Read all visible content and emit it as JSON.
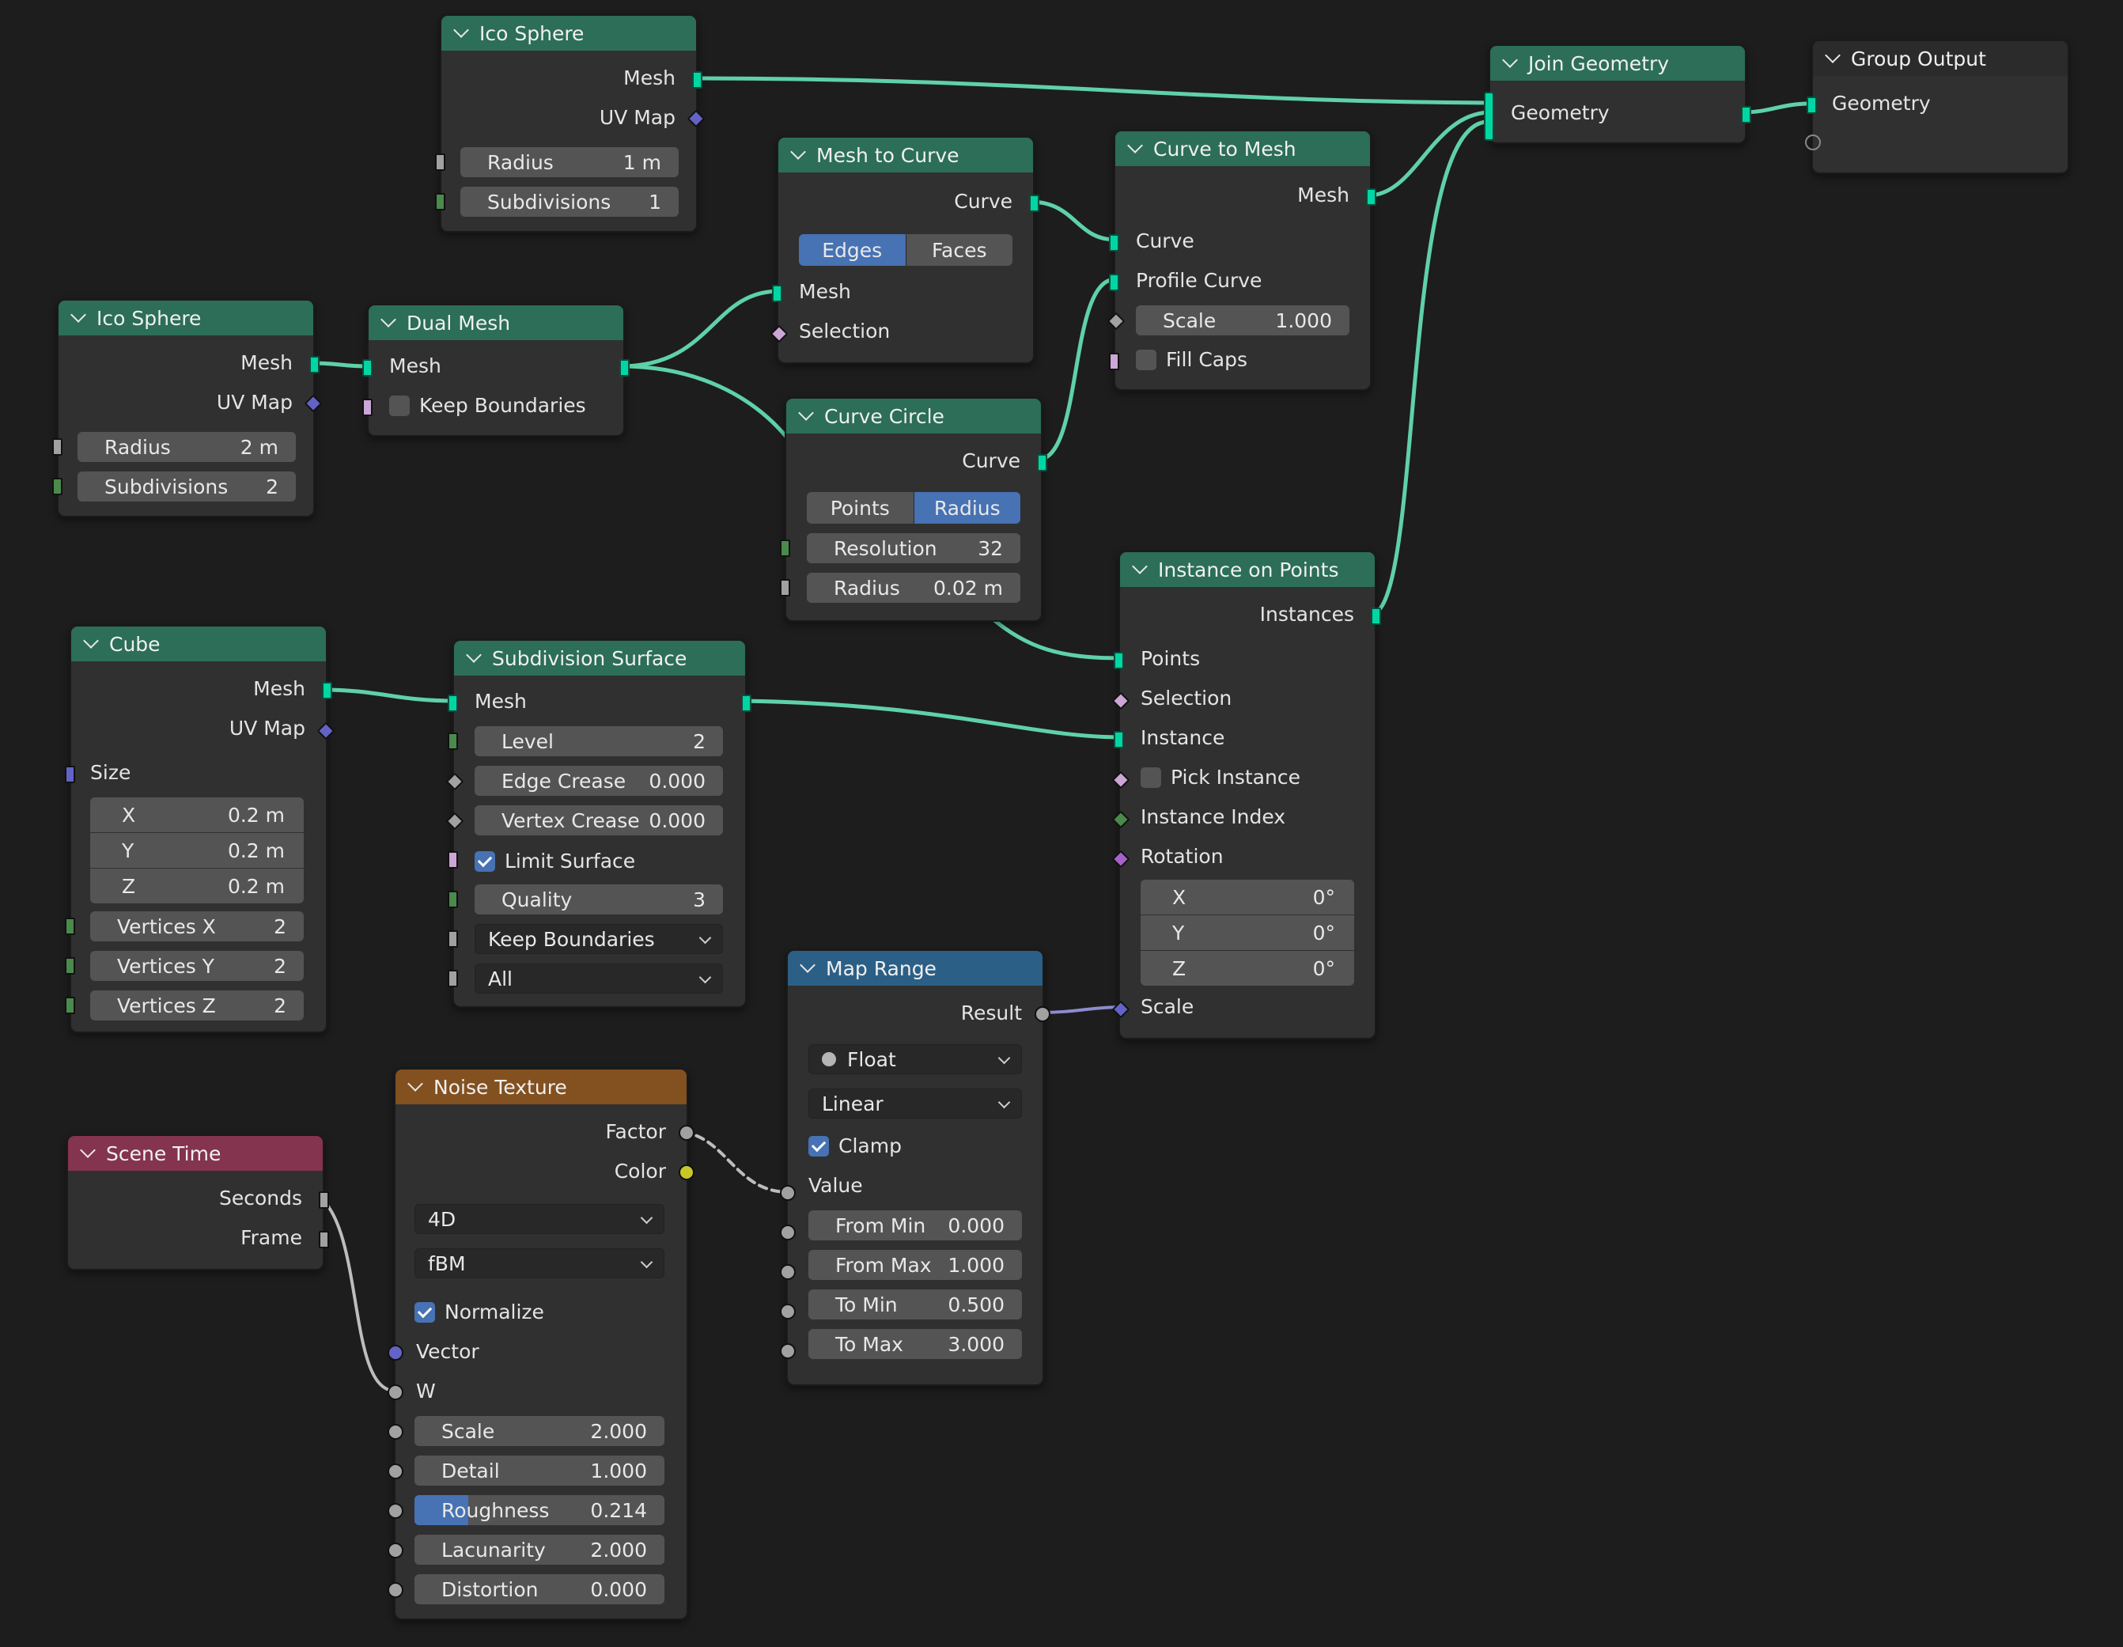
{
  "colors": {
    "background": "#1d1d1d",
    "geometry_header": "#2c6e58",
    "texture_header": "#83501f",
    "converter_header": "#2b5f86",
    "input_header": "#84344e",
    "geometry_link": "#00d6a3",
    "float_link": "#a1a1a1",
    "accent": "#4772b3"
  },
  "nodes": {
    "ico_top": {
      "title": "Ico Sphere",
      "out_mesh": "Mesh",
      "out_uv": "UV Map",
      "radius_label": "Radius",
      "radius_value": "1 m",
      "subdiv_label": "Subdivisions",
      "subdiv_value": "1"
    },
    "ico_left": {
      "title": "Ico Sphere",
      "out_mesh": "Mesh",
      "out_uv": "UV Map",
      "radius_label": "Radius",
      "radius_value": "2 m",
      "subdiv_label": "Subdivisions",
      "subdiv_value": "2"
    },
    "dual_mesh": {
      "title": "Dual Mesh",
      "in_mesh": "Mesh",
      "keep_boundaries": "Keep Boundaries"
    },
    "mesh_to_curve": {
      "title": "Mesh to Curve",
      "out_curve": "Curve",
      "mode_edges": "Edges",
      "mode_faces": "Faces",
      "in_mesh": "Mesh",
      "in_selection": "Selection"
    },
    "curve_to_mesh": {
      "title": "Curve to Mesh",
      "out_mesh": "Mesh",
      "in_curve": "Curve",
      "in_profile": "Profile Curve",
      "scale_label": "Scale",
      "scale_value": "1.000",
      "fill_caps": "Fill Caps"
    },
    "join_geometry": {
      "title": "Join Geometry",
      "geometry": "Geometry"
    },
    "group_output": {
      "title": "Group Output",
      "geometry": "Geometry"
    },
    "curve_circle": {
      "title": "Curve Circle",
      "out_curve": "Curve",
      "mode_points": "Points",
      "mode_radius": "Radius",
      "res_label": "Resolution",
      "res_value": "32",
      "radius_label": "Radius",
      "radius_value": "0.02 m"
    },
    "instance_on_points": {
      "title": "Instance on Points",
      "out_instances": "Instances",
      "in_points": "Points",
      "in_selection": "Selection",
      "in_instance": "Instance",
      "pick_instance": "Pick Instance",
      "instance_index": "Instance Index",
      "rotation": "Rotation",
      "rx_label": "X",
      "rx_value": "0°",
      "ry_label": "Y",
      "ry_value": "0°",
      "rz_label": "Z",
      "rz_value": "0°",
      "scale": "Scale"
    },
    "cube": {
      "title": "Cube",
      "out_mesh": "Mesh",
      "out_uv": "UV Map",
      "size": "Size",
      "x_label": "X",
      "x_value": "0.2 m",
      "y_label": "Y",
      "y_value": "0.2 m",
      "z_label": "Z",
      "z_value": "0.2 m",
      "vx_label": "Vertices X",
      "vx_value": "2",
      "vy_label": "Vertices Y",
      "vy_value": "2",
      "vz_label": "Vertices Z",
      "vz_value": "2"
    },
    "subdivision_surface": {
      "title": "Subdivision Surface",
      "in_mesh": "Mesh",
      "level_label": "Level",
      "level_value": "2",
      "edge_label": "Edge Crease",
      "edge_value": "0.000",
      "vertex_label": "Vertex Crease",
      "vertex_value": "0.000",
      "limit_surface": "Limit Surface",
      "quality_label": "Quality",
      "quality_value": "3",
      "boundary_option": "Keep Boundaries",
      "uv_option": "All"
    },
    "map_range": {
      "title": "Map Range",
      "out_result": "Result",
      "data_type": "Float",
      "interpolation": "Linear",
      "clamp": "Clamp",
      "in_value": "Value",
      "from_min_label": "From Min",
      "from_min_value": "0.000",
      "from_max_label": "From Max",
      "from_max_value": "1.000",
      "to_min_label": "To Min",
      "to_min_value": "0.500",
      "to_max_label": "To Max",
      "to_max_value": "3.000"
    },
    "noise_texture": {
      "title": "Noise Texture",
      "out_factor": "Factor",
      "out_color": "Color",
      "dimensions": "4D",
      "noise_type": "fBM",
      "normalize": "Normalize",
      "in_vector": "Vector",
      "in_w": "W",
      "scale_label": "Scale",
      "scale_value": "2.000",
      "detail_label": "Detail",
      "detail_value": "1.000",
      "roughness_label": "Roughness",
      "roughness_value": "0.214",
      "roughness_fraction": 0.214,
      "lacunarity_label": "Lacunarity",
      "lacunarity_value": "2.000",
      "distortion_label": "Distortion",
      "distortion_value": "0.000"
    },
    "scene_time": {
      "title": "Scene Time",
      "out_seconds": "Seconds",
      "out_frame": "Frame"
    }
  }
}
